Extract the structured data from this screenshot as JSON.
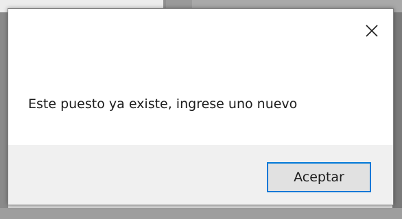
{
  "dialog": {
    "message": "Este puesto ya existe, ingrese uno nuevo",
    "close_icon": "close-icon",
    "ok_label": "Aceptar"
  },
  "colors": {
    "accent_border": "#0078d7",
    "footer_bg": "#f0f0f0",
    "button_bg": "#e1e1e1",
    "text": "#1b1b1b"
  }
}
